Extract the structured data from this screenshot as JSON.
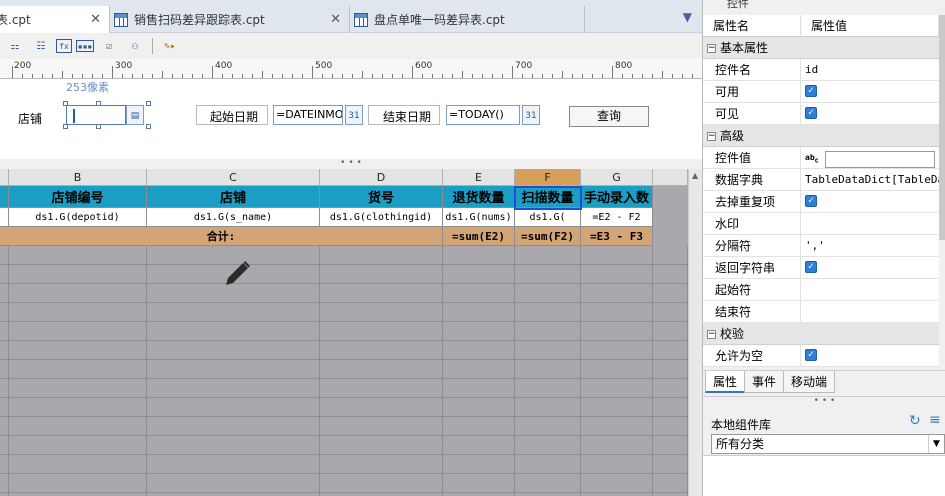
{
  "tabs": [
    {
      "label": "表.cpt",
      "active": true
    },
    {
      "label": "销售扫码差异跟踪表.cpt",
      "active": false
    },
    {
      "label": "盘点单唯一码差异表.cpt",
      "active": false
    }
  ],
  "toolbar": {
    "icons": [
      "layout-icon",
      "grid-icon",
      "fx-icon",
      "textbox-icon",
      "checkbox-icon",
      "tree-icon",
      "preview-icon"
    ]
  },
  "ruler": {
    "labels": [
      "200",
      "300",
      "400",
      "500",
      "600",
      "700",
      "800"
    ]
  },
  "form": {
    "size_hint": "253像素",
    "store_label": "店铺",
    "start_label": "起始日期",
    "start_value": "=DATEINMONTH",
    "end_label": "结束日期",
    "end_value": "=TODAY()",
    "query_label": "查询",
    "cal_text": "31"
  },
  "grid": {
    "col_letters": [
      "B",
      "C",
      "D",
      "E",
      "F",
      "G"
    ],
    "headers": [
      "店铺编号",
      "店铺",
      "货号",
      "退货数量",
      "扫描数量",
      "手动录入数"
    ],
    "data_row": [
      "ds1.G(depotid)",
      "ds1.G(s_name)",
      "ds1.G(clothingid)",
      "ds1.G(nums)",
      "ds1.G(",
      "=E2 - F2"
    ],
    "total_label": "合计:",
    "total_row": [
      "=sum(E2)",
      "=sum(F2)",
      "=E3 - F3"
    ]
  },
  "panel": {
    "top_label": "控件",
    "col_name": "属性名",
    "col_value": "属性值",
    "cat_basic": "基本属性",
    "widget_name_label": "控件名",
    "widget_name_value": "id",
    "enabled_label": "可用",
    "visible_label": "可见",
    "cat_advanced": "高级",
    "widget_value_label": "控件值",
    "dict_label": "数据字典",
    "dict_value": "TableDataDict[TableData",
    "dedupe_label": "去掉重复项",
    "watermark_label": "水印",
    "separator_label": "分隔符",
    "separator_value": "','",
    "return_string_label": "返回字符串",
    "start_char_label": "起始符",
    "end_char_label": "结束符",
    "cat_validation": "校验",
    "allow_empty_label": "允许为空",
    "tabs": [
      "属性",
      "事件",
      "移动端"
    ],
    "library_title": "本地组件库",
    "library_select": "所有分类"
  }
}
